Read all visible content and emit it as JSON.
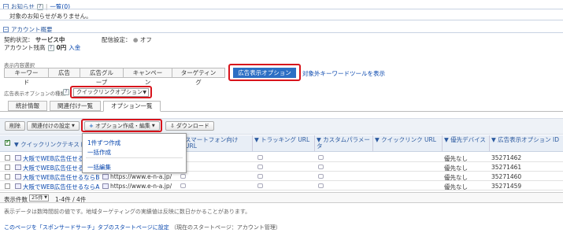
{
  "notice": {
    "title": "お知らせ",
    "help": "?",
    "list_link": "一覧(0)",
    "empty_message": "対象のお知らせがありません。"
  },
  "account": {
    "title": "アカウント概要",
    "contract_label": "契約状況：",
    "contract_value": "サービス中",
    "delivery_label": "配信設定：",
    "delivery_value": "オフ",
    "balance_label": "アカウント残高",
    "balance_value": "0円",
    "deposit_link": "入金"
  },
  "display_content": {
    "label": "表示内容選択",
    "tabs": [
      "キーワード",
      "広告",
      "広告グループ",
      "キャンペーン",
      "ターゲティング",
      "広告表示オプション"
    ],
    "active_tab_index": 5,
    "external_link": "対象外キーワードツールを表示"
  },
  "option_type": {
    "label": "広告表示オプションの種類",
    "selected": "クイックリンクオプション"
  },
  "subtabs": [
    "統計情報",
    "関連付け一覧",
    "オプション一覧"
  ],
  "active_subtab_index": 2,
  "toolbar": {
    "delete": "削除",
    "association": "関連付けの設定",
    "create_edit": "オプション作成・編集",
    "download": "ダウンロード"
  },
  "dropdown_menu": [
    "1件ずつ作成",
    "一括作成",
    "一括編集"
  ],
  "table": {
    "columns": [
      "クイックリンクテキスト",
      "スマートフォン向け URL",
      "トラッキング URL",
      "カスタムパラメータ",
      "クイックリンク URL",
      "優先デバイス",
      "広告表示オプション ID"
    ],
    "rows": [
      {
        "text": "大阪でWEB広告任せるなら",
        "url": "",
        "device": "優先なし",
        "id": "35271462"
      },
      {
        "text": "大阪でWEB広告任せるなら",
        "url": "",
        "device": "優先なし",
        "id": "35271461"
      },
      {
        "text": "大阪でWEB広告任せるならB",
        "url": "https://www.e-n-a.jp/",
        "device": "優先なし",
        "id": "35271460"
      },
      {
        "text": "大阪でWEB広告任せるならA",
        "url": "https://www.e-n-a.jp/",
        "device": "優先なし",
        "id": "35271459"
      }
    ]
  },
  "pagination": {
    "per_page_label": "表示件数",
    "per_page_value": "25件",
    "range": "1-4件 / 4件"
  },
  "footer_note": "表示データは数時間前の値です。地域ターゲティングの実績値は反映に数日かかることがあります。",
  "start_page": {
    "link": "このページを「スポンサードサーチ」タブのスタートページに設定",
    "current": "（現在のスタートページ：アカウント管理）"
  },
  "colors": {
    "active_tab": "#2c6fc4",
    "highlight": "#d8141c",
    "header_band": "#e8eef6"
  }
}
